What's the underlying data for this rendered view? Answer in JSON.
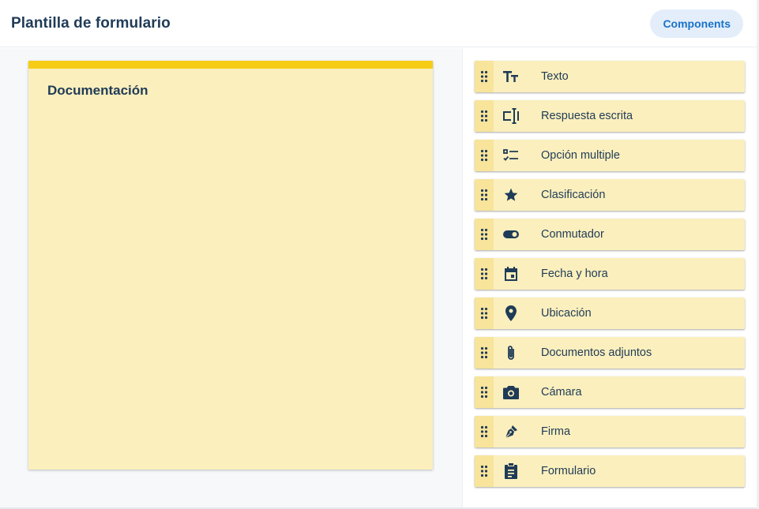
{
  "header": {
    "title": "Plantilla de formulario",
    "components_button": "Components"
  },
  "form": {
    "title": "Documentación",
    "accent_color": "#f7cc14",
    "card_color": "#fbefbd"
  },
  "components": [
    {
      "label": "Texto",
      "icon": "text-format-icon"
    },
    {
      "label": "Respuesta escrita",
      "icon": "text-field-icon"
    },
    {
      "label": "Opción multiple",
      "icon": "checklist-icon"
    },
    {
      "label": "Clasificación",
      "icon": "star-icon"
    },
    {
      "label": "Conmutador",
      "icon": "toggle-icon"
    },
    {
      "label": "Fecha y hora",
      "icon": "calendar-icon"
    },
    {
      "label": "Ubicación",
      "icon": "location-pin-icon"
    },
    {
      "label": "Documentos adjuntos",
      "icon": "paperclip-icon"
    },
    {
      "label": "Cámara",
      "icon": "camera-icon"
    },
    {
      "label": "Firma",
      "icon": "pen-icon"
    },
    {
      "label": "Formulario",
      "icon": "clipboard-icon"
    }
  ],
  "colors": {
    "text": "#1f3b57",
    "button_bg": "#e3eefa",
    "button_text": "#1a73c8"
  }
}
